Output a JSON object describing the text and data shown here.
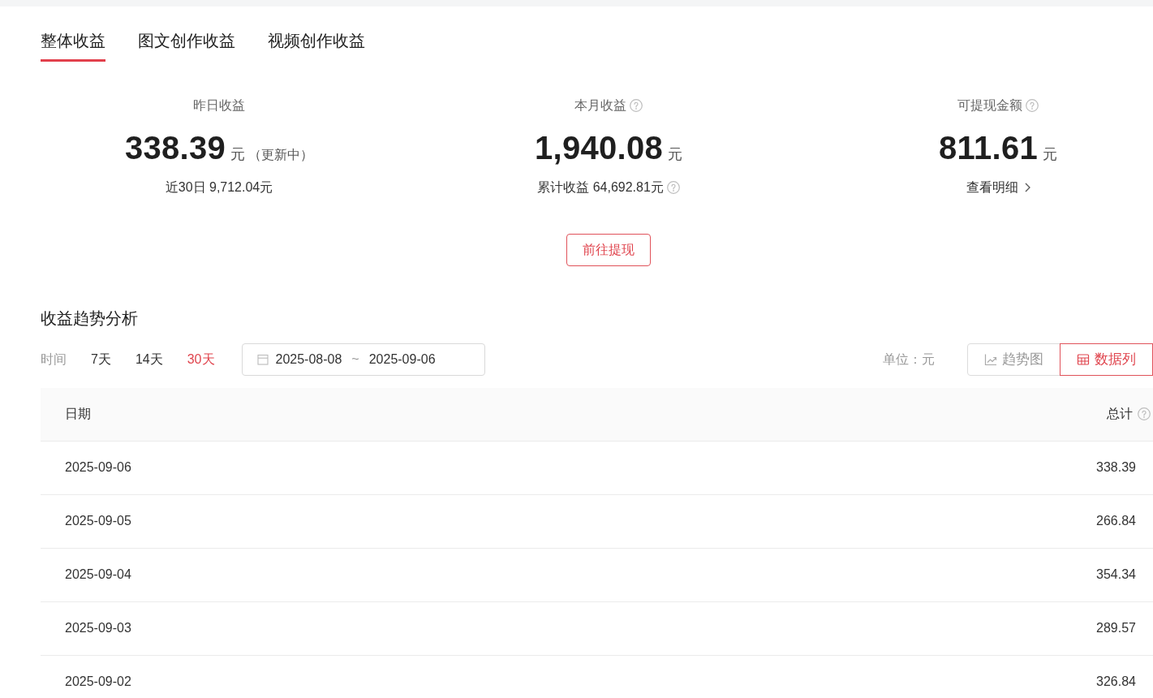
{
  "tabs": [
    {
      "label": "整体收益",
      "selected": true
    },
    {
      "label": "图文创作收益",
      "selected": false
    },
    {
      "label": "视频创作收益",
      "selected": false
    }
  ],
  "overview": {
    "stats": [
      {
        "label": "昨日收益",
        "help": false,
        "value": "338.39",
        "unit": "元",
        "note": "（更新中）",
        "footer": {
          "text": "近30日 9,712.04元",
          "help": false,
          "link": false
        }
      },
      {
        "label": "本月收益",
        "help": true,
        "value": "1,940.08",
        "unit": "元",
        "footer": {
          "text": "累计收益 64,692.81元",
          "help": true,
          "link": false
        }
      },
      {
        "label": "可提现金额",
        "help": true,
        "value": "811.61",
        "unit": "元",
        "footer": {
          "text": "查看明细",
          "help": false,
          "link": true
        }
      }
    ],
    "withdraw_button": "前往提现"
  },
  "trend": {
    "title": "收益趋势分析",
    "filter_label": "时间",
    "ranges": [
      {
        "label": "7天",
        "selected": false
      },
      {
        "label": "14天",
        "selected": false
      },
      {
        "label": "30天",
        "selected": true
      }
    ],
    "date_range": {
      "start": "2025-08-08",
      "separator": "~",
      "end": "2025-09-06"
    },
    "unit_label": "单位：元",
    "views": [
      {
        "kind": "chart",
        "label": "趋势图",
        "selected": false
      },
      {
        "kind": "table",
        "label": "数据列",
        "selected": true
      }
    ]
  },
  "table": {
    "columns": [
      {
        "label": "日期",
        "help": false
      },
      {
        "label": "总计",
        "help": true
      }
    ],
    "rows": [
      [
        "2025-09-06",
        "338.39"
      ],
      [
        "2025-09-05",
        "266.84"
      ],
      [
        "2025-09-04",
        "354.34"
      ],
      [
        "2025-09-03",
        "289.57"
      ],
      [
        "2025-09-02",
        "326.84"
      ]
    ]
  }
}
